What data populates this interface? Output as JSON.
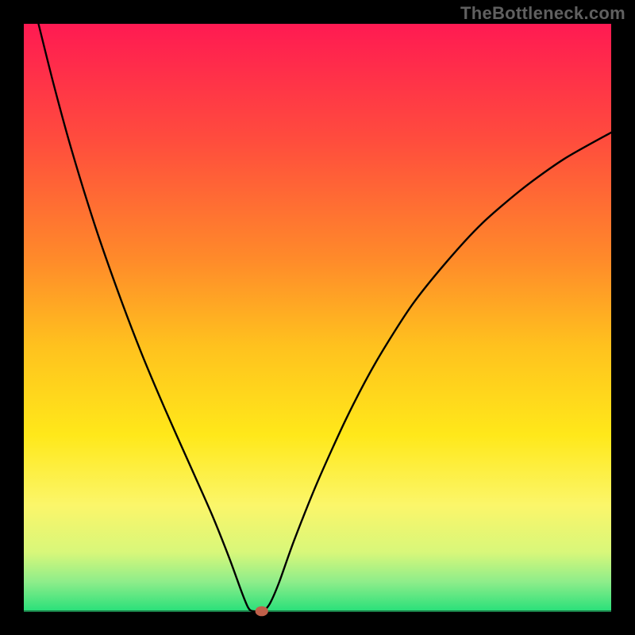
{
  "watermark": "TheBottleneck.com",
  "chart_data": {
    "type": "line",
    "title": "",
    "xlabel": "",
    "ylabel": "",
    "xlim": [
      0,
      100
    ],
    "ylim": [
      0,
      100
    ],
    "background_gradient": {
      "stops": [
        {
          "offset": 0.0,
          "color": "#ff1a52"
        },
        {
          "offset": 0.2,
          "color": "#ff4d3d"
        },
        {
          "offset": 0.4,
          "color": "#ff8a2a"
        },
        {
          "offset": 0.55,
          "color": "#ffc21e"
        },
        {
          "offset": 0.7,
          "color": "#ffe81a"
        },
        {
          "offset": 0.82,
          "color": "#fbf66a"
        },
        {
          "offset": 0.9,
          "color": "#d8f77a"
        },
        {
          "offset": 0.95,
          "color": "#8eed8a"
        },
        {
          "offset": 1.0,
          "color": "#29e07a"
        }
      ]
    },
    "optimum": {
      "x": 39,
      "y": 0
    },
    "curve_points": [
      {
        "x": 2.5,
        "y": 100.0
      },
      {
        "x": 5.0,
        "y": 90.0
      },
      {
        "x": 8.0,
        "y": 79.0
      },
      {
        "x": 12.0,
        "y": 66.0
      },
      {
        "x": 16.0,
        "y": 54.5
      },
      {
        "x": 20.0,
        "y": 44.0
      },
      {
        "x": 24.0,
        "y": 34.5
      },
      {
        "x": 28.0,
        "y": 25.5
      },
      {
        "x": 32.0,
        "y": 16.5
      },
      {
        "x": 35.0,
        "y": 9.0
      },
      {
        "x": 37.0,
        "y": 3.5
      },
      {
        "x": 38.0,
        "y": 1.0
      },
      {
        "x": 38.5,
        "y": 0.2
      },
      {
        "x": 39.0,
        "y": 0.0
      },
      {
        "x": 40.0,
        "y": 0.0
      },
      {
        "x": 41.0,
        "y": 0.2
      },
      {
        "x": 42.0,
        "y": 1.5
      },
      {
        "x": 43.5,
        "y": 5.0
      },
      {
        "x": 46.0,
        "y": 12.0
      },
      {
        "x": 50.0,
        "y": 22.0
      },
      {
        "x": 55.0,
        "y": 33.0
      },
      {
        "x": 60.0,
        "y": 42.5
      },
      {
        "x": 66.0,
        "y": 52.0
      },
      {
        "x": 72.0,
        "y": 59.5
      },
      {
        "x": 78.0,
        "y": 66.0
      },
      {
        "x": 85.0,
        "y": 72.0
      },
      {
        "x": 92.0,
        "y": 77.0
      },
      {
        "x": 100.0,
        "y": 81.5
      }
    ],
    "marker": {
      "x": 40.5,
      "y": 0.0,
      "rx": 1.1,
      "ry": 0.85,
      "color": "#c0604a"
    }
  }
}
